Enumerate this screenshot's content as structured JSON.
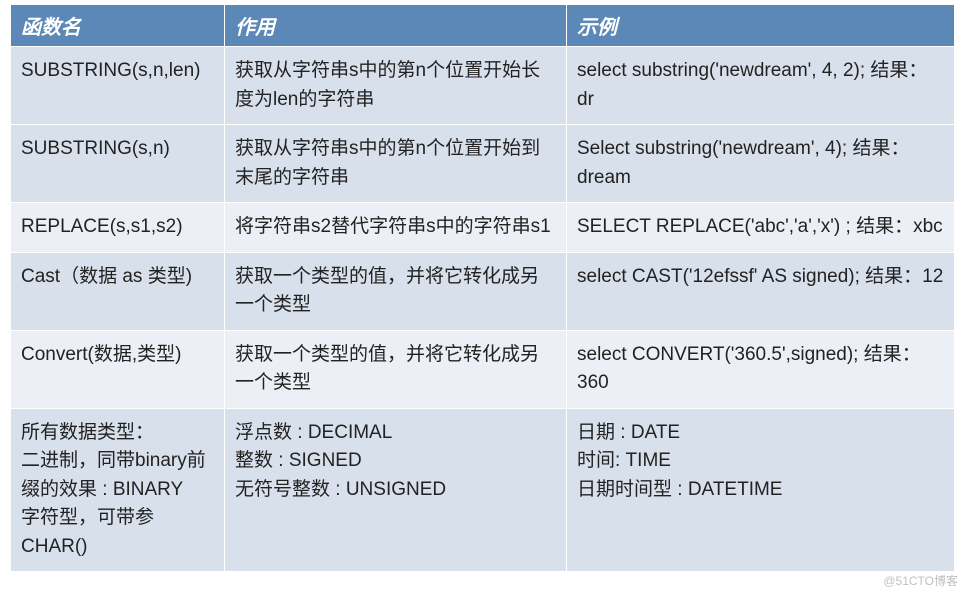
{
  "headers": {
    "name": "函数名",
    "desc": "作用",
    "example": "示例"
  },
  "rows": [
    {
      "name": "SUBSTRING(s,n,len)",
      "desc": "获取从字符串s中的第n个位置开始长度为len的字符串",
      "example": "select substring('newdream', 4, 2); 结果：dr"
    },
    {
      "name": "SUBSTRING(s,n)",
      "desc": "获取从字符串s中的第n个位置开始到末尾的字符串",
      "example": "Select substring('newdream', 4); 结果：dream"
    },
    {
      "name": "REPLACE(s,s1,s2)",
      "desc": "将字符串s2替代字符串s中的字符串s1",
      "example": "SELECT REPLACE('abc','a','x') ; 结果：xbc"
    },
    {
      "name": "Cast（数据 as 类型)",
      "desc": "获取一个类型的值，并将它转化成另一个类型",
      "example": "select  CAST('12efssf' AS signed); 结果：12"
    },
    {
      "name": "Convert(数据,类型)",
      "desc": "获取一个类型的值，并将它转化成另一个类型",
      "example": "select CONVERT('360.5',signed); 结果：360"
    },
    {
      "name": "所有数据类型：\n二进制，同带binary前缀的效果 : BINARY\n 字符型，可带参CHAR()",
      "desc": "浮点数 : DECIMAL\n整数 : SIGNED\n无符号整数 : UNSIGNED",
      "example": "日期 : DATE\n时间: TIME\n日期时间型 : DATETIME"
    }
  ],
  "watermark": "@51CTO博客"
}
